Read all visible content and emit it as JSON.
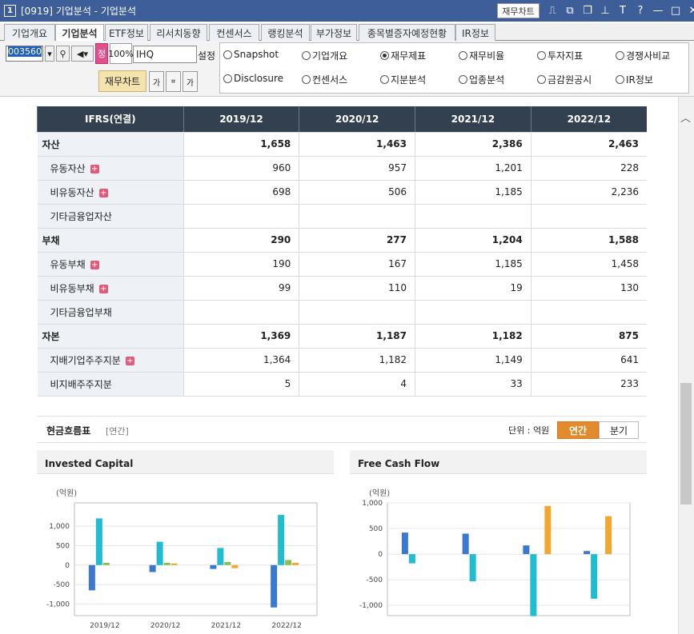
{
  "window": {
    "number": "1",
    "title": "[0919] 기업분석 - 기업분석",
    "chart_button": "재무차트"
  },
  "window_icons": [
    {
      "icon": "chart-icon",
      "g": "⎍"
    },
    {
      "icon": "popout-icon",
      "g": "⧉"
    },
    {
      "icon": "copy-icon",
      "g": "❐"
    },
    {
      "icon": "pin-icon",
      "g": "⊥"
    },
    {
      "icon": "font-icon",
      "g": "T"
    },
    {
      "icon": "help-icon",
      "g": "?"
    },
    {
      "icon": "minimize-icon",
      "g": "—"
    },
    {
      "icon": "maximize-icon",
      "g": "□"
    },
    {
      "icon": "close-icon",
      "g": "✕"
    }
  ],
  "tabs": [
    "기업개요",
    "기업분석",
    "ETF정보",
    "리서치동향",
    "컨센서스",
    "랭킹분석",
    "부가정보",
    "종목별증자예정현황",
    "IR정보"
  ],
  "toolbar": {
    "code": "003560",
    "badge": "정",
    "zoom": "100%",
    "name": "IHQ",
    "settings": "설정",
    "chart_btn": "재무차트",
    "ga": "가"
  },
  "radios": [
    {
      "label": "Snapshot",
      "checked": false
    },
    {
      "label": "기업개요",
      "checked": false
    },
    {
      "label": "재무제표",
      "checked": true
    },
    {
      "label": "재무비율",
      "checked": false
    },
    {
      "label": "투자지표",
      "checked": false
    },
    {
      "label": "경쟁사비교",
      "checked": false
    },
    {
      "label": "Disclosure",
      "checked": false
    },
    {
      "label": "컨센서스",
      "checked": false
    },
    {
      "label": "지분분석",
      "checked": false
    },
    {
      "label": "업종분석",
      "checked": false
    },
    {
      "label": "금감원공시",
      "checked": false
    },
    {
      "label": "IR정보",
      "checked": false
    }
  ],
  "table": {
    "header": [
      "IFRS(연결)",
      "2019/12",
      "2020/12",
      "2021/12",
      "2022/12"
    ],
    "rows": [
      {
        "label": "자산",
        "values": [
          "1,658",
          "1,463",
          "2,386",
          "2,463"
        ],
        "main": true,
        "plus": false
      },
      {
        "label": "유동자산",
        "values": [
          "960",
          "957",
          "1,201",
          "228"
        ],
        "main": false,
        "plus": true
      },
      {
        "label": "비유동자산",
        "values": [
          "698",
          "506",
          "1,185",
          "2,236"
        ],
        "main": false,
        "plus": true
      },
      {
        "label": "기타금융업자산",
        "values": [
          "",
          "",
          "",
          ""
        ],
        "main": false,
        "plus": false
      },
      {
        "label": "부채",
        "values": [
          "290",
          "277",
          "1,204",
          "1,588"
        ],
        "main": true,
        "plus": false
      },
      {
        "label": "유동부채",
        "values": [
          "190",
          "167",
          "1,185",
          "1,458"
        ],
        "main": false,
        "plus": true
      },
      {
        "label": "비유동부채",
        "values": [
          "99",
          "110",
          "19",
          "130"
        ],
        "main": false,
        "plus": true
      },
      {
        "label": "기타금융업부채",
        "values": [
          "",
          "",
          "",
          ""
        ],
        "main": false,
        "plus": false
      },
      {
        "label": "자본",
        "values": [
          "1,369",
          "1,187",
          "1,182",
          "875"
        ],
        "main": true,
        "plus": false
      },
      {
        "label": "지배기업주주지분",
        "values": [
          "1,364",
          "1,182",
          "1,149",
          "641"
        ],
        "main": false,
        "plus": true
      },
      {
        "label": "비지배주주지분",
        "values": [
          "5",
          "4",
          "33",
          "233"
        ],
        "main": false,
        "plus": false
      }
    ]
  },
  "cashflow": {
    "title": "현금흐름표",
    "sub": "[연간]",
    "unit": "단위 : 억원",
    "annual": "연간",
    "quarter": "분기"
  },
  "colors": {
    "blue": "#3b78d0",
    "cyan": "#20bcd0",
    "green": "#8bbf4a",
    "orange": "#f0a830"
  },
  "chart_data": [
    {
      "type": "bar",
      "title": "Invested Capital",
      "ylabel": "(억원)",
      "categories": [
        "2019/12",
        "2020/12",
        "2021/12",
        "2022/12"
      ],
      "ylim": [
        -1300,
        1600
      ],
      "ticks": [
        1000,
        500,
        0,
        -500,
        -1000
      ],
      "tick_labels": [
        "1,000",
        "500",
        "0",
        "-500",
        "-1,000"
      ],
      "category_labels": [
        "2019/12",
        "2020/12",
        "2021/12",
        "2022/12"
      ],
      "series": [
        {
          "values": [
            -650,
            -180,
            -100,
            -1090
          ]
        },
        {
          "values": [
            1200,
            600,
            440,
            1290
          ]
        },
        {
          "values": [
            60,
            60,
            80,
            130
          ]
        },
        {
          "values": [
            0,
            40,
            -80,
            60
          ]
        }
      ]
    },
    {
      "type": "bar",
      "title": "Free Cash Flow",
      "ylabel": "(억원)",
      "categories": [
        "",
        "",
        "",
        ""
      ],
      "ylim": [
        -1200,
        1000
      ],
      "ticks": [
        1000,
        500,
        0,
        -500,
        -1000
      ],
      "tick_labels": [
        "1,000",
        "500",
        "0",
        "-500",
        "-1,000"
      ],
      "series": [
        {
          "values": [
            420,
            400,
            170,
            60
          ]
        },
        {
          "values": [
            -180,
            -530,
            -1210,
            -870
          ]
        },
        {
          "values": [
            0,
            0,
            0,
            0
          ]
        },
        {
          "values": [
            0,
            0,
            940,
            740
          ]
        }
      ]
    }
  ]
}
